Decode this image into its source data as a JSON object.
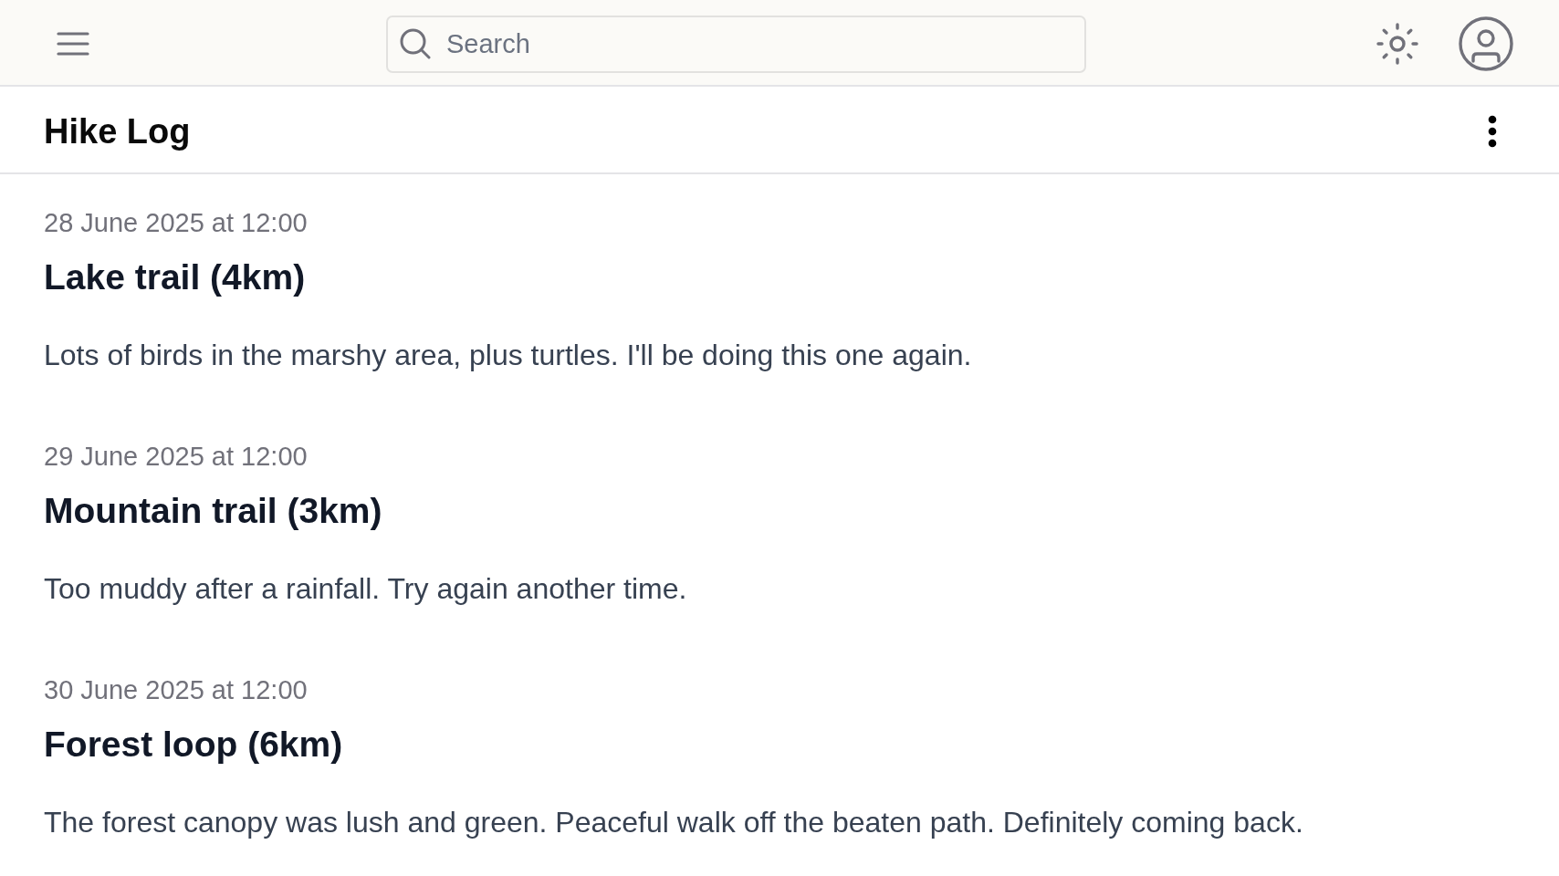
{
  "top_bar": {
    "search": {
      "placeholder": "Search"
    }
  },
  "header": {
    "title": "Hike Log"
  },
  "entries": [
    {
      "date": "28 June 2025 at 12:00",
      "title": "Lake trail (4km)",
      "note": "Lots of birds in the marshy area, plus turtles. I'll be doing this one again."
    },
    {
      "date": "29 June 2025 at 12:00",
      "title": "Mountain trail (3km)",
      "note": "Too muddy after a rainfall. Try again another time."
    },
    {
      "date": "30 June 2025 at 12:00",
      "title": "Forest loop (6km)",
      "note": "The forest canopy was lush and green. Peaceful walk off the beaten path. Definitely coming back."
    }
  ]
}
